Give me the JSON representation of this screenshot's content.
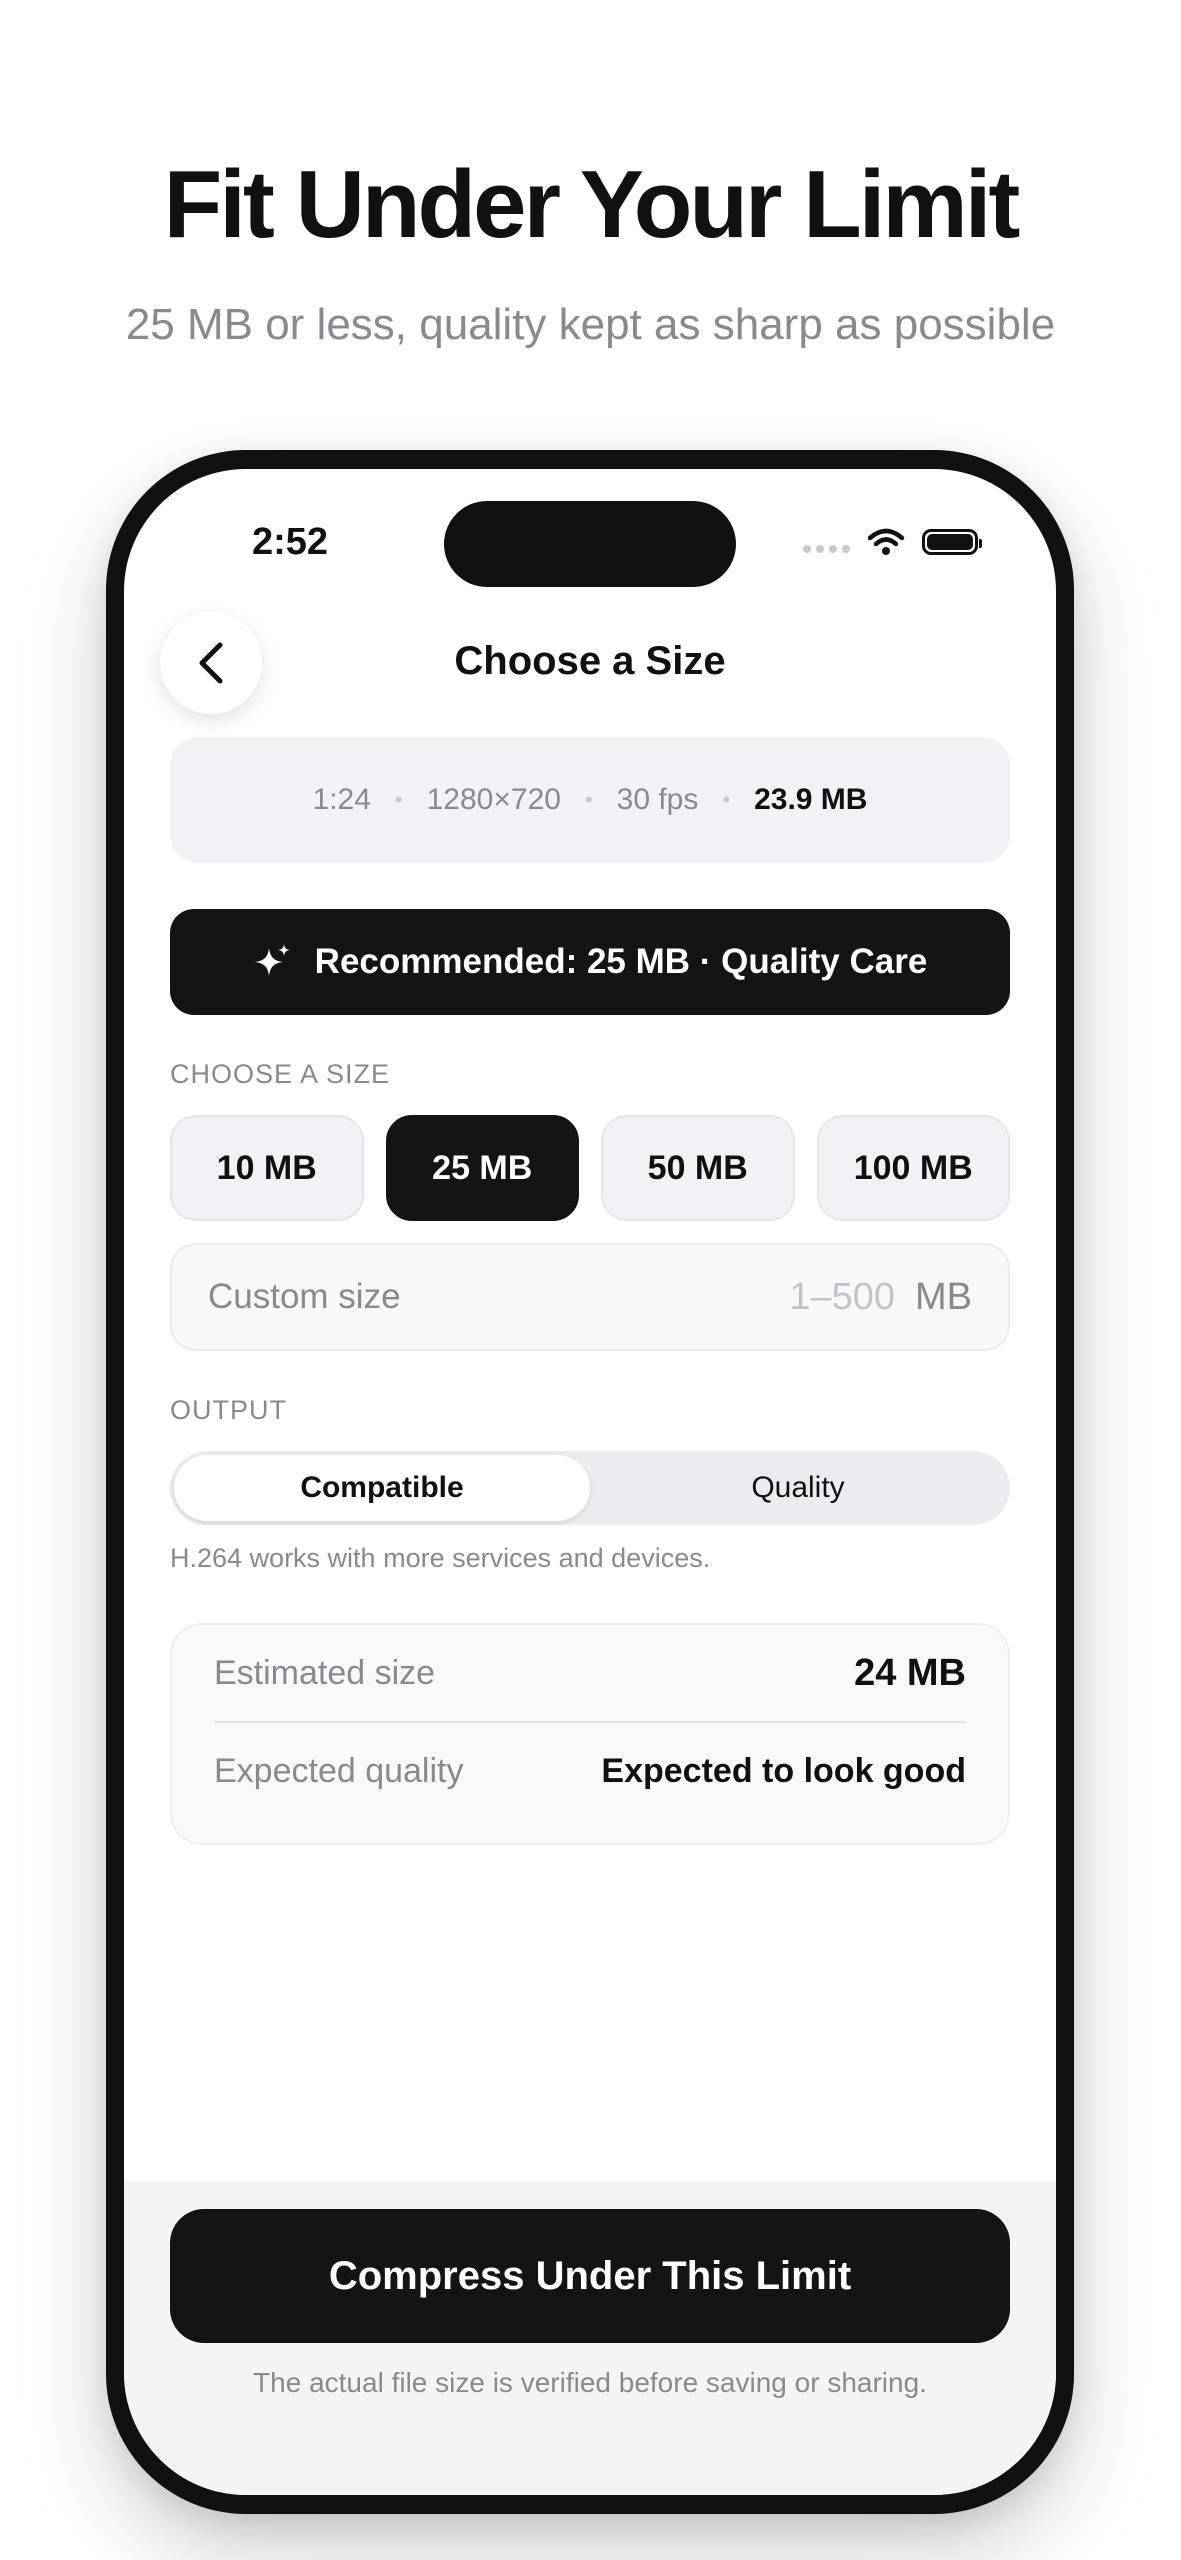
{
  "headline": "Fit Under Your Limit",
  "subheadline": "25 MB or less, quality kept as sharp as possible",
  "status_bar": {
    "time": "2:52"
  },
  "nav": {
    "title": "Choose a Size",
    "back_icon": "chevron-left-icon"
  },
  "video_meta": {
    "duration": "1:24",
    "resolution": "1280×720",
    "fps": "30 fps",
    "file_size": "23.9 MB"
  },
  "recommendation": {
    "icon": "sparkle-icon",
    "text": "Recommended: 25 MB · Quality Care"
  },
  "size_section": {
    "label": "CHOOSE A SIZE",
    "options": [
      "10 MB",
      "25 MB",
      "50 MB",
      "100 MB"
    ],
    "selected": "25 MB"
  },
  "custom_size": {
    "label": "Custom size",
    "placeholder": "1–500",
    "unit": "MB"
  },
  "output_section": {
    "label": "OUTPUT",
    "options": [
      "Compatible",
      "Quality"
    ],
    "selected": "Compatible",
    "helper": "H.264 works with more services and devices."
  },
  "estimate": {
    "size_label": "Estimated size",
    "size_value": "24 MB",
    "quality_label": "Expected quality",
    "quality_value": "Expected to look good"
  },
  "primary_action": {
    "label": "Compress Under This Limit"
  },
  "footnote": "The actual file size is verified before saving or sharing.",
  "colors": {
    "accent": "#141414",
    "muted_text": "#8a8a8e",
    "card_bg": "#f2f2f4",
    "background": "#ffffff"
  }
}
